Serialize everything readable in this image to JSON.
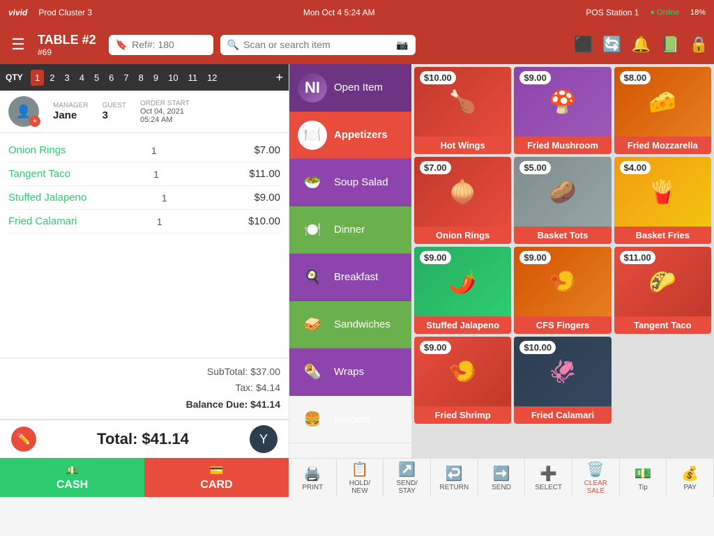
{
  "topbar": {
    "brand": "vivid",
    "cluster": "Prod Cluster 3",
    "datetime": "Mon Oct 4  5:24 AM",
    "pos": "POS Station 1",
    "online": "Online",
    "battery": "18%"
  },
  "header": {
    "table_num": "TABLE #2",
    "table_sub": "#69",
    "ref_placeholder": "Ref#: 180",
    "search_placeholder": "Scan or search item"
  },
  "qty_bar": {
    "label": "QTY",
    "numbers": [
      "1",
      "2",
      "3",
      "4",
      "5",
      "6",
      "7",
      "8",
      "9",
      "10",
      "11",
      "12"
    ],
    "active": "1"
  },
  "order_info": {
    "manager_label": "MANAGER",
    "manager_name": "Jane",
    "guest_label": "GUEST",
    "guest_count": "3",
    "order_start_label": "ORDER START",
    "order_start_date": "Oct 04, 2021",
    "order_start_time": "05:24 AM"
  },
  "order_items": [
    {
      "name": "Onion Rings",
      "qty": "1",
      "price": "$7.00"
    },
    {
      "name": "Tangent Taco",
      "qty": "1",
      "price": "$11.00"
    },
    {
      "name": "Stuffed Jalapeno",
      "qty": "1",
      "price": "$9.00"
    },
    {
      "name": "Fried Calamari",
      "qty": "1",
      "price": "$10.00"
    }
  ],
  "totals": {
    "subtotal_label": "SubTotal:",
    "subtotal": "$37.00",
    "tax_label": "Tax:",
    "tax": "$4.14",
    "balance_label": "Balance Due:",
    "balance": "$41.14"
  },
  "total_bar": {
    "total_label": "Total:",
    "total_amount": "$41.14"
  },
  "payment": {
    "cash_label": "CASH",
    "card_label": "CARD"
  },
  "categories": [
    {
      "id": "open-item",
      "label": "Open Item",
      "icon": "🆕"
    },
    {
      "id": "appetizers",
      "label": "Appetizers",
      "icon": "🍗",
      "active": true
    },
    {
      "id": "soup-salad",
      "label": "Soup Salad",
      "icon": "🥗"
    },
    {
      "id": "dinner",
      "label": "Dinner",
      "icon": "🍽️"
    },
    {
      "id": "breakfast",
      "label": "Breakfast",
      "icon": "🍳"
    },
    {
      "id": "sandwiches",
      "label": "Sandwiches",
      "icon": "🥪"
    },
    {
      "id": "wraps",
      "label": "Wraps",
      "icon": "🌯"
    },
    {
      "id": "burgers",
      "label": "Burgers",
      "icon": "🍔"
    }
  ],
  "food_items": [
    {
      "name": "Hot Wings",
      "price": "$10.00",
      "img_class": "img-hotwings",
      "emoji": "🍗"
    },
    {
      "name": "Fried Mushroom",
      "price": "$9.00",
      "img_class": "img-friedmush",
      "emoji": "🍄"
    },
    {
      "name": "Fried Mozzarella",
      "price": "$8.00",
      "img_class": "img-friedmozz",
      "emoji": "🧀"
    },
    {
      "name": "Onion Rings",
      "price": "$7.00",
      "img_class": "img-onionrings",
      "emoji": "🧅"
    },
    {
      "name": "Basket Tots",
      "price": "$5.00",
      "img_class": "img-baskettots",
      "emoji": "🥔"
    },
    {
      "name": "Basket Fries",
      "price": "$4.00",
      "img_class": "img-basketfries",
      "emoji": "🍟"
    },
    {
      "name": "Stuffed Jalapeno",
      "price": "$9.00",
      "img_class": "img-stuffedjalap",
      "emoji": "🌶️"
    },
    {
      "name": "CFS Fingers",
      "price": "$9.00",
      "img_class": "img-cfsfingers",
      "emoji": "🍤"
    },
    {
      "name": "Tangent Taco",
      "price": "$11.00",
      "img_class": "img-tangenttaco",
      "emoji": "🌮"
    },
    {
      "name": "Fried Shrimp",
      "price": "$9.00",
      "img_class": "img-friedshrimp",
      "emoji": "🍤"
    },
    {
      "name": "Fried Calamari",
      "price": "$10.00",
      "img_class": "img-friedcalam",
      "emoji": "🦑"
    }
  ],
  "actions": [
    {
      "id": "print",
      "label": "PRINT",
      "icon": "🖨️"
    },
    {
      "id": "hold-new",
      "label": "HOLD/\nNEW",
      "icon": "📋"
    },
    {
      "id": "send-stay",
      "label": "SEND/\nSTAY",
      "icon": "↗️"
    },
    {
      "id": "return",
      "label": "RETURN",
      "icon": "↩️"
    },
    {
      "id": "send",
      "label": "SEND",
      "icon": "➡️"
    },
    {
      "id": "select",
      "label": "SELECT",
      "icon": "➕"
    },
    {
      "id": "clear-sale",
      "label": "CLEAR\nSALE",
      "icon": "🗑️"
    },
    {
      "id": "tip",
      "label": "Tip",
      "icon": "💵"
    },
    {
      "id": "pay",
      "label": "PAY",
      "icon": "💰"
    }
  ]
}
